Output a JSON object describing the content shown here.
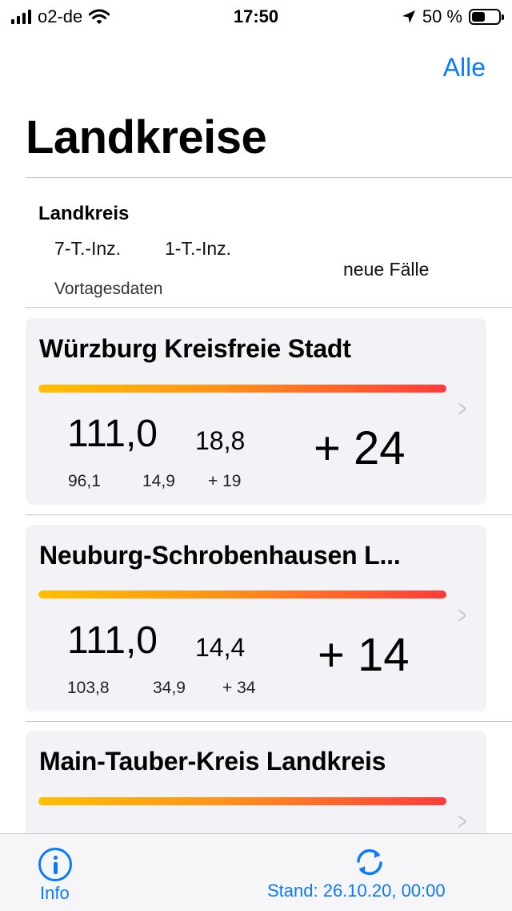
{
  "status_bar": {
    "carrier": "o2-de",
    "time": "17:50",
    "battery_percent": "50 %",
    "battery_level": 0.5
  },
  "nav": {
    "right_button": "Alle"
  },
  "page_title": "Landkreise",
  "legend": {
    "title": "Landkreis",
    "seven_day": "7-T.-Inz.",
    "one_day": "1-T.-Inz.",
    "new_cases": "neue Fälle",
    "previous_day": "Vortagesdaten"
  },
  "cards": [
    {
      "name": "Würzburg Kreisfreie Stadt",
      "inz7": "111,0",
      "inz1": "18,8",
      "new_cases": "+ 24",
      "prev_inz7": "96,1",
      "prev_inz1": "14,9",
      "prev_new": "+ 19"
    },
    {
      "name": "Neuburg-Schrobenhausen L...",
      "inz7": "111,0",
      "inz1": "14,4",
      "new_cases": "+ 14",
      "prev_inz7": "103,8",
      "prev_inz1": "34,9",
      "prev_new": "+ 34"
    },
    {
      "name": "Main-Tauber-Kreis Landkreis"
    }
  ],
  "tabbar": {
    "info_label": "Info",
    "stand_label": "Stand: 26.10.20, 00:00"
  },
  "colors": {
    "accent": "#0a7aff",
    "card_bg": "#f2f2f7",
    "gradient_start": "#ffc000",
    "gradient_end": "#ff3b3b"
  },
  "icons": [
    "signal-icon",
    "wifi-icon",
    "location-arrow-icon",
    "battery-icon",
    "chevron-right-icon",
    "info-icon",
    "refresh-icon"
  ]
}
